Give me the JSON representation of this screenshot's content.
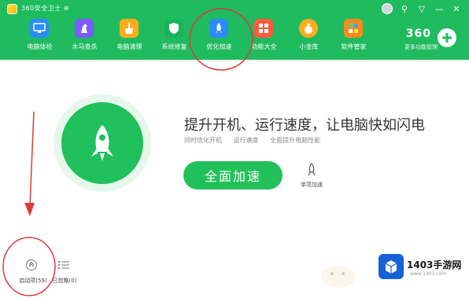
{
  "window": {
    "title": "360安全卫士 ⊕",
    "system_buttons": [
      "⚲",
      "▽",
      "—",
      "✕"
    ]
  },
  "nav": {
    "items": [
      {
        "label": "电脑体检",
        "icon": "monitor-icon",
        "color": "#2a8cff"
      },
      {
        "label": "木马查杀",
        "icon": "horse-icon",
        "color": "#7b5cff"
      },
      {
        "label": "电脑清理",
        "icon": "broom-icon",
        "color": "#ffae1a"
      },
      {
        "label": "系统修复",
        "icon": "shield-icon",
        "color": "#19b45a"
      },
      {
        "label": "优化加速",
        "icon": "rocket-icon",
        "color": "#2a8cff"
      },
      {
        "label": "功能大全",
        "icon": "grid-icon",
        "color": "#ff5a3c"
      },
      {
        "label": "小金库",
        "icon": "money-bag-icon",
        "color": "#ffae1a"
      },
      {
        "label": "软件管家",
        "icon": "apps-icon",
        "color": "#ff8a1a"
      }
    ]
  },
  "brand": {
    "logo_text": "360",
    "subtitle": "更多功能管理"
  },
  "hero": {
    "headline": "提升开机、运行速度，让电脑快如闪电",
    "sublines": [
      "同时优化开机",
      "运行速度",
      "全面提升电脑性能"
    ]
  },
  "actions": {
    "accelerate_all": "全面加速",
    "single_accelerate": "单项加速"
  },
  "bottom": {
    "startup_label": "启动项(59)",
    "optimized_label": "已忽略(0)"
  },
  "watermark": {
    "brand": "1403手游网",
    "url": "www.1403.com"
  },
  "colors": {
    "header_green": "#1fbb5e",
    "accent_green": "#22c05a",
    "annotation_red": "#d93b3b"
  }
}
